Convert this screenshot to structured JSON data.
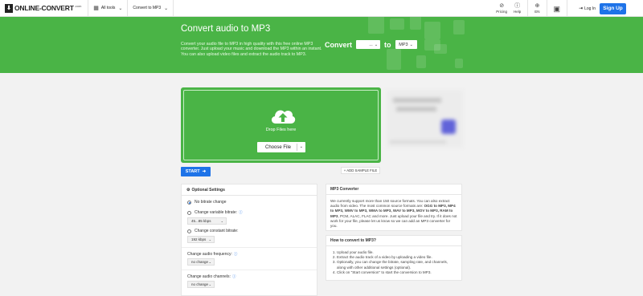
{
  "nav": {
    "logo_text": "ONLINE-CONVERT",
    "logo_suffix": ".com",
    "all_tools": "All tools",
    "convert_to": "Convert to MP3",
    "pricing": "Pricing",
    "help": "Help",
    "language": "EN",
    "login": "Log In",
    "signup": "Sign Up"
  },
  "hero": {
    "title": "Convert audio to MP3",
    "description": "Convert your audio file to MP3 in high quality with this free online MP3 converter. Just upload your music and download the MP3 within an instant. You can also upload video files and extract the audio track to MP3.",
    "convert_label": "Convert",
    "from_value": "...",
    "to_label": "to",
    "to_value": "MP3"
  },
  "upload": {
    "drop_text": "Drop Files here",
    "choose_file": "Choose File"
  },
  "actions": {
    "start": "START",
    "add_sample": "ADD SAMPLE FILE"
  },
  "settings": {
    "header": "Optional Settings",
    "no_bitrate": "No bitrate change",
    "variable_bitrate": "Change variable bitrate:",
    "variable_value": "45...85 kbps",
    "constant_bitrate": "Change constant bitrate:",
    "constant_value": "192 kbps",
    "frequency_label": "Change audio frequency:",
    "frequency_value": "no change",
    "channels_label": "Change audio channels:",
    "channels_value": "no change"
  },
  "info_box": {
    "title": "MP3 Converter",
    "text_1": "We currently support more than 150 source formats. You can also extract audio from video. The most common source formats are: ",
    "formats": "OGG to MP3, MP4 to MP3, WMV to MP3, WMA to MP3, WAV to MP3, MOV to MP3, RAM to MP3",
    "text_2": ", PCM, ALAC, FLAC and more. Just upload your file and try. If it does not work for your file, please let us know so we can add an MP3 converter for you."
  },
  "howto_box": {
    "title": "How to convert to MP3?",
    "steps": [
      "Upload your audio file.",
      "Extract the audio track of a video by uploading a video file.",
      "Optionally, you can change the bitrate, sampling rate, and channels, along with other additional settings (optional).",
      "Click on \"Start conversion\" to start the conversion to MP3."
    ]
  }
}
